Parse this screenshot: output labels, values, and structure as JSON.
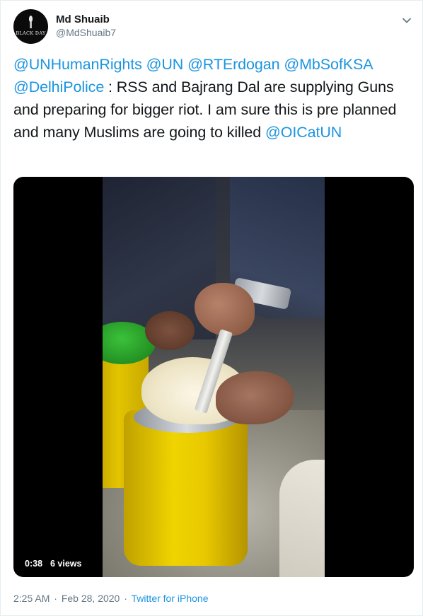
{
  "author": {
    "display_name": "Md Shuaib",
    "handle": "@MdShuaib7",
    "avatar_text": "BLACK DAY"
  },
  "tweet": {
    "segments": [
      {
        "text": "@UNHumanRights",
        "type": "mention"
      },
      {
        "text": " ",
        "type": "text"
      },
      {
        "text": "@UN",
        "type": "mention"
      },
      {
        "text": " ",
        "type": "text"
      },
      {
        "text": "@RTErdogan",
        "type": "mention"
      },
      {
        "text": " ",
        "type": "text"
      },
      {
        "text": "@MbSofKSA",
        "type": "mention"
      },
      {
        "text": " ",
        "type": "text"
      },
      {
        "text": "@DelhiPolice",
        "type": "mention"
      },
      {
        "text": " : RSS and Bajrang Dal are supplying Guns and preparing for bigger riot. I am sure this is pre planned and many Muslims are going to killed ",
        "type": "text"
      },
      {
        "text": "@OICatUN",
        "type": "mention"
      }
    ]
  },
  "media": {
    "duration": "0:38",
    "views": "6 views"
  },
  "meta": {
    "time": "2:25 AM",
    "separator": "·",
    "date": "Feb 28, 2020",
    "source": "Twitter for iPhone"
  },
  "colors": {
    "link": "#1b95e0",
    "secondary_text": "#657786",
    "primary_text": "#14171a"
  },
  "icons": {
    "menu": "chevron-down-icon"
  }
}
